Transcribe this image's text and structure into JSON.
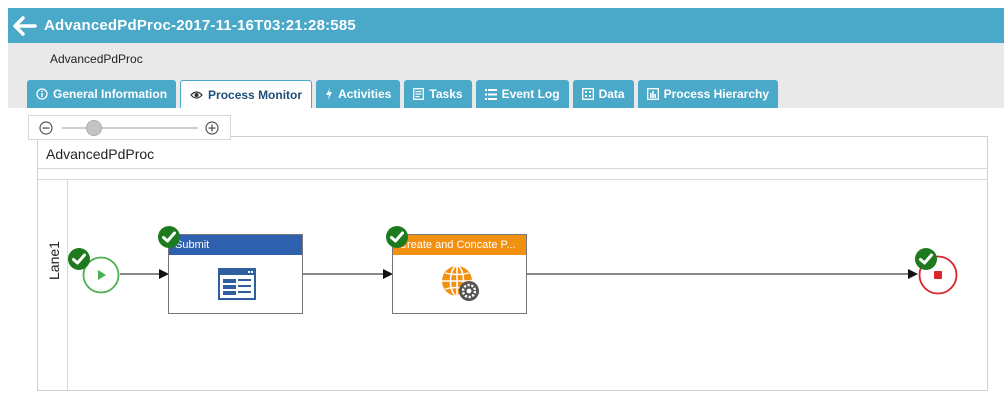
{
  "header": {
    "title": "AdvancedPdProc-2017-11-16T03:21:28:585"
  },
  "subheader": {
    "process_name": "AdvancedPdProc"
  },
  "tabs": [
    {
      "label": "General Information",
      "icon": "info-icon"
    },
    {
      "label": "Process Monitor",
      "icon": "eye-icon"
    },
    {
      "label": "Activities",
      "icon": "bolt-icon"
    },
    {
      "label": "Tasks",
      "icon": "tasks-icon"
    },
    {
      "label": "Event Log",
      "icon": "list-icon"
    },
    {
      "label": "Data",
      "icon": "data-icon"
    },
    {
      "label": "Process Hierarchy",
      "icon": "hierarchy-icon"
    }
  ],
  "active_tab": "Process Monitor",
  "zoom": {
    "level": 0.2
  },
  "diagram": {
    "pool_name": "AdvancedPdProc",
    "lane_name": "Lane1",
    "tasks": [
      {
        "label": "Submit",
        "header_color": "#2f5faf",
        "icon": "form-icon",
        "status": "completed"
      },
      {
        "label": "Create and Concate P...",
        "header_color": "#f29111",
        "icon": "web-service-icon",
        "status": "completed"
      }
    ],
    "start_event": {
      "status": "completed"
    },
    "end_event": {
      "status": "completed"
    }
  },
  "colors": {
    "accent": "#4aa8c9",
    "success": "#1e7a1e",
    "start": "#4caf50",
    "end": "#d9232d"
  }
}
